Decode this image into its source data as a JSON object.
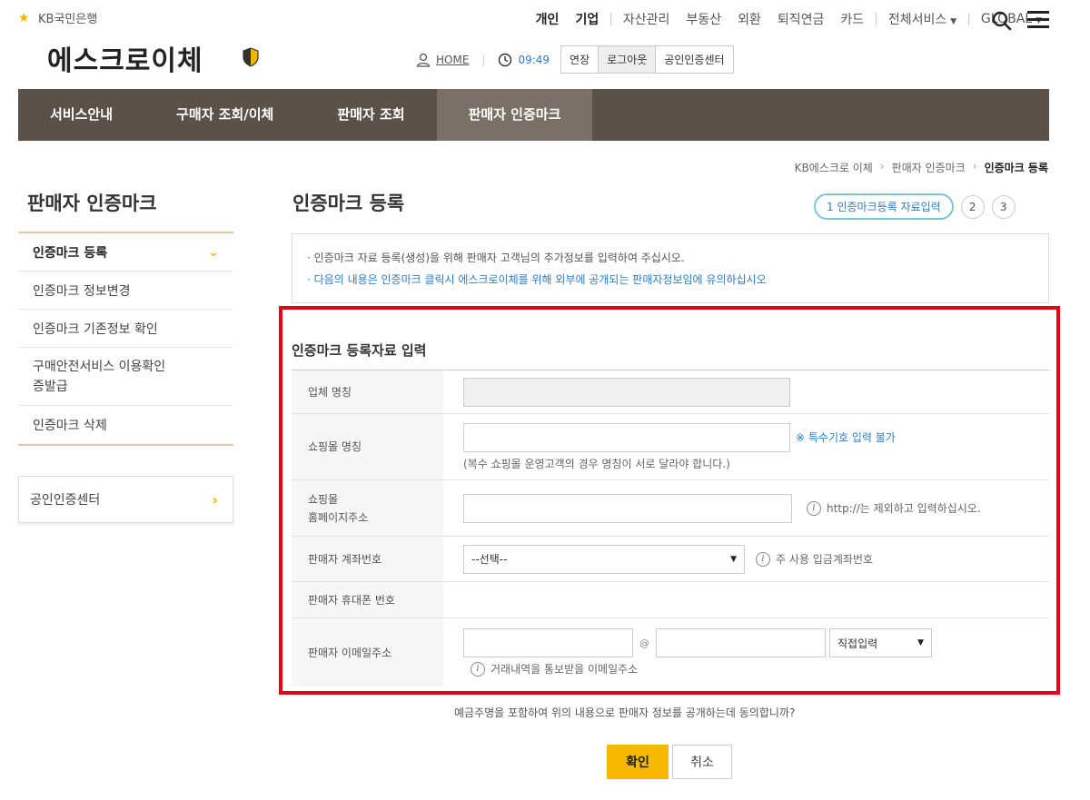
{
  "header": {
    "logo_text": "KB국민은행",
    "brand": "에스크로이체",
    "topnav": [
      "개인",
      "기업",
      "자산관리",
      "부동산",
      "외환",
      "퇴직연금",
      "카드",
      "전체서비스",
      "GLOBAL"
    ],
    "home_label": "HOME",
    "time": "09:49",
    "session_buttons": [
      "연장",
      "로그아웃",
      "공인인증센터"
    ]
  },
  "mainnav": {
    "items": [
      "서비스안내",
      "구매자 조회/이체",
      "판매자 조회",
      "판매자 인증마크"
    ]
  },
  "breadcrumb": [
    "KB에스크로 이체",
    "판매자 인증마크",
    "인증마크 등록"
  ],
  "sidebar": {
    "title": "판매자 인증마크",
    "items": [
      {
        "label": "인증마크 등록"
      },
      {
        "label": "인증마크 정보변경"
      },
      {
        "label": "인증마크 기존정보 확인"
      },
      {
        "label": "구매안전서비스 이용확인\n증발급"
      },
      {
        "label": "인증마크 삭제"
      }
    ],
    "cert_center": "공인인증센터"
  },
  "content": {
    "title": "인증마크 등록",
    "steps": {
      "current": "1 인증마크등록 자료입력",
      "step2": "2",
      "step3": "3"
    },
    "notice": {
      "line1": "· 인증마크 자료 등록(생성)을 위해 판매자 고객님의 추가정보를 입력하여 주십시오.",
      "line2": "· 다음의 내용은 인증마크 클릭시 에스크로이체를 위해 외부에 공개되는 판매자정보임에 유의하십시오"
    },
    "form_title": "인증마크 등록자료 입력",
    "form": {
      "company_label": "업체 명칭",
      "mall_label": "쇼핑몰 명칭",
      "mall_hint_special": "※ 특수기호 입력 불가",
      "mall_hint_multi": "(복수 쇼핑몰 운영고객의 경우 명칭이 서로 달라야 합니다.)",
      "homepage_label": "쇼핑몰\n홈페이지주소",
      "homepage_hint": "http://는 제외하고 입력하십시오.",
      "account_label": "판매자 계좌번호",
      "account_select": "--선택--",
      "account_hint": "주 사용 입금계좌번호",
      "phone_label": "판매자 휴대폰 번호",
      "email_label": "판매자 이메일주소",
      "email_at": "@",
      "email_domain_select": "직접입력",
      "email_hint": "거래내역을 통보받을 이메일주소"
    },
    "agree_text": "예금주명을 포함하여 위의 내용으로 판매자 정보를 공개하는데 동의합니까?",
    "ok_label": "확인",
    "cancel_label": "취소"
  }
}
